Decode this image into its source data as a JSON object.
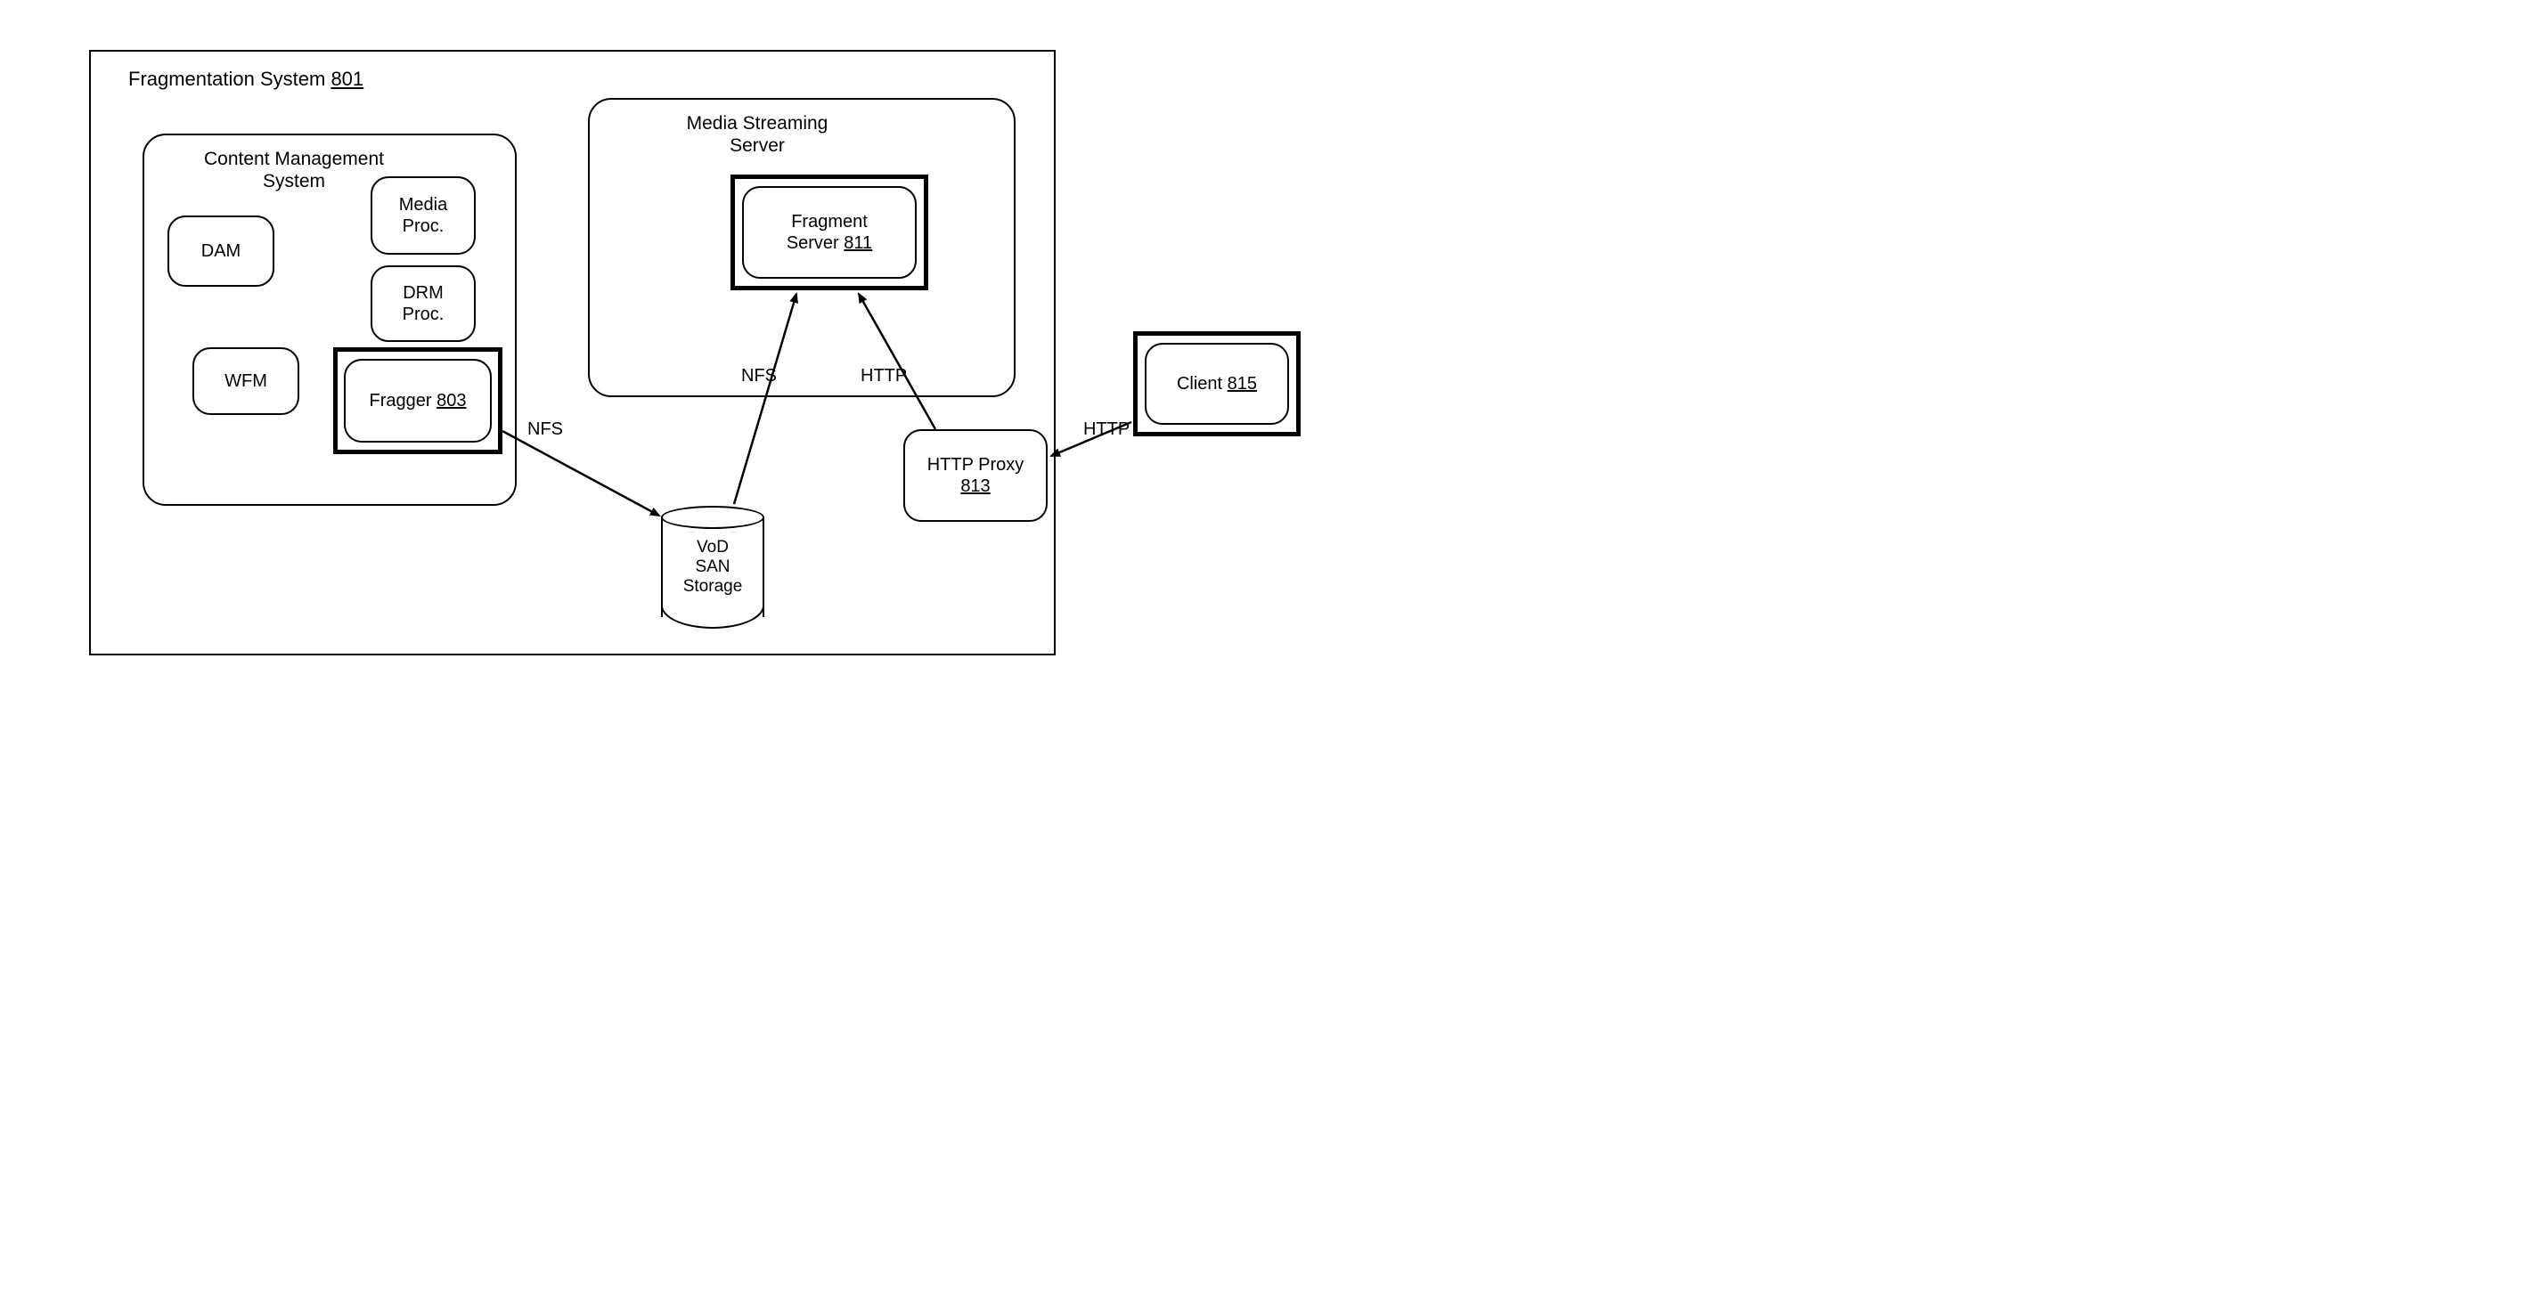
{
  "outer": {
    "title_prefix": "Fragmentation System ",
    "title_num": "801"
  },
  "cms": {
    "title_l1": "Content Management",
    "title_l2": "System",
    "dam": "DAM",
    "wfm": "WFM",
    "media_proc_l1": "Media",
    "media_proc_l2": "Proc.",
    "drm_proc_l1": "DRM",
    "drm_proc_l2": "Proc.",
    "fragger_prefix": "Fragger ",
    "fragger_num": "803"
  },
  "mss": {
    "title_l1": "Media Streaming",
    "title_l2": "Server",
    "fragserver_l1": "Fragment",
    "fragserver_prefix": "Server ",
    "fragserver_num": "811"
  },
  "storage": {
    "l1": "VoD",
    "l2": "SAN",
    "l3": "Storage"
  },
  "proxy": {
    "l1": "HTTP Proxy",
    "num": "813"
  },
  "client": {
    "prefix": "Client ",
    "num": "815"
  },
  "edges": {
    "nfs1": "NFS",
    "nfs2": "NFS",
    "http1": "HTTP",
    "http2": "HTTP"
  }
}
